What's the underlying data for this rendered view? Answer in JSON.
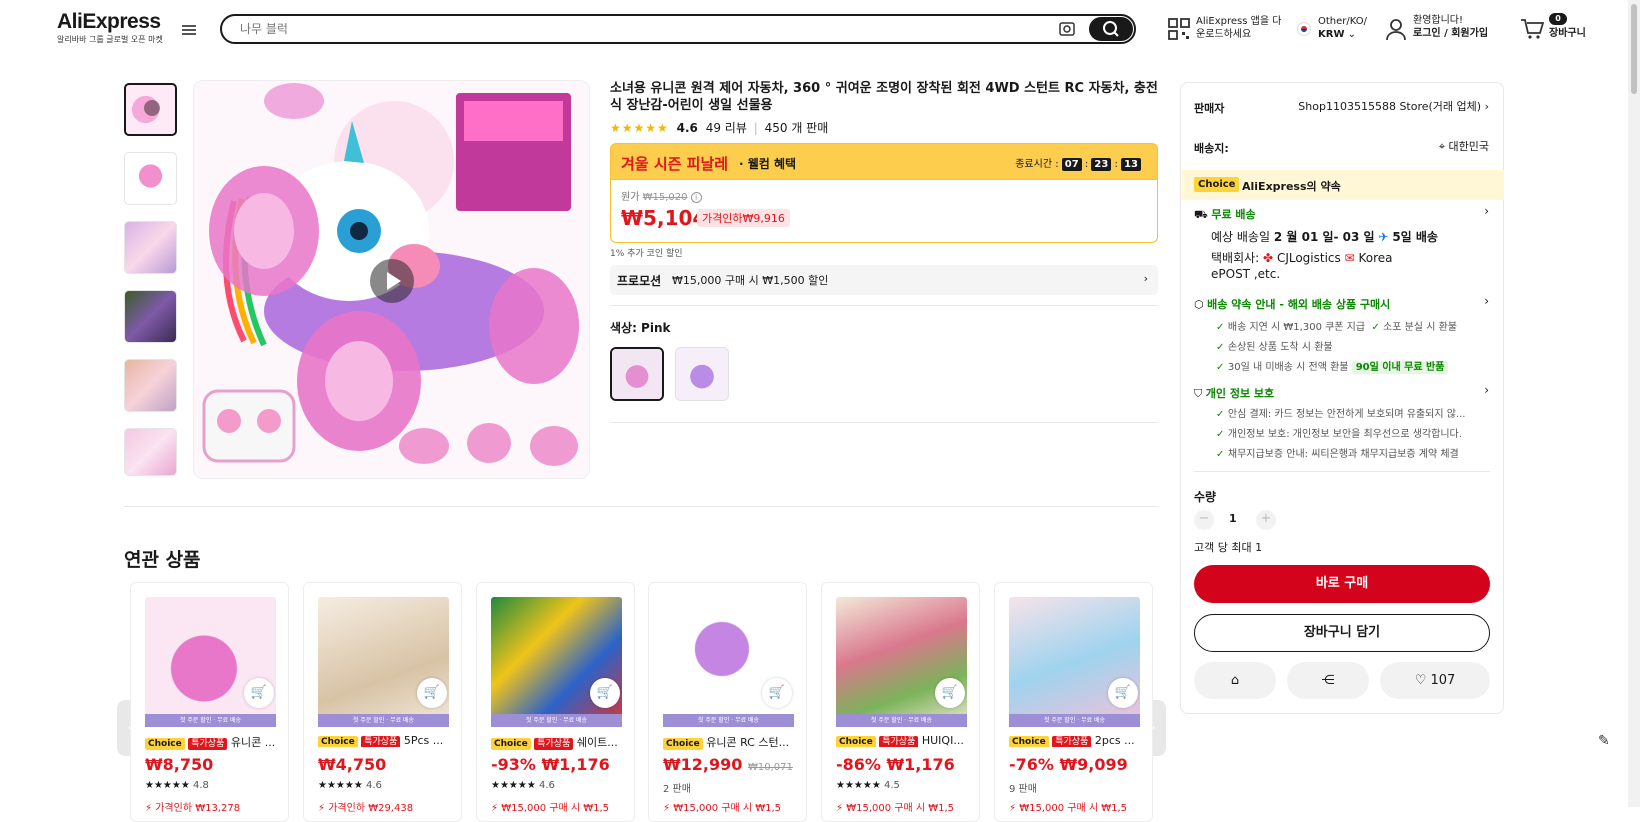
{
  "header": {
    "logo": "AliExpress",
    "logo_sub": "알리바바 그룹 글로벌 오픈 마켓",
    "search_placeholder": "나무 블럭",
    "app_line1": "AliExpress 앱을 다",
    "app_line2": "운로드하세요",
    "region_line1": "Other/KO/",
    "region_line2": "KRW",
    "account_line1": "환영합니다!",
    "account_line2": "로그인 / 회원가입",
    "cart_count": "0",
    "cart_label": "장바구니"
  },
  "product": {
    "title": "소녀용 유니콘 원격 제어 자동차, 360 ° 귀여운 조명이 장착된 회전 4WD 스턴트 RC 자동차, 충전식 장난감-어린이 생일 선물용",
    "rating": "4.6",
    "reviews": "49 리뷰",
    "sold": "450 개 판매",
    "sale_title": "겨울 시즌 피날레",
    "sale_sub": "· 웰컴 혜택",
    "timer_label": "종료시간 :",
    "timer_h": "07",
    "timer_m": "23",
    "timer_s": "13",
    "orig_label": "원가",
    "orig_price": "₩15,020",
    "price": "₩5,104",
    "discount_tag": "가격인하₩9,916",
    "coin": "1% 추가 코인 할인",
    "promo_label": "프로모션",
    "promo_text": "₩15,000 구매 시 ₩1,500 할인",
    "color_label": "색상: Pink"
  },
  "panel": {
    "seller_label": "판매자",
    "seller_name": "Shop1103515588 Store(거래 업체)",
    "ship_to_label": "배송지:",
    "ship_to": "대한민국",
    "choice_tag": "Choice",
    "choice_title": "AliExpress의 약속",
    "free_ship": "무료 배송",
    "eta_prefix": "예상 배송일",
    "eta_dates": "2 월 01 일- 03 일",
    "eta_days": "5일 배송",
    "carrier_label": "택배회사:",
    "carrier1": "CJLogistics",
    "carrier2": "Korea",
    "carrier3": "ePOST ,etc.",
    "promise_title": "배송 약속 안내 - 해외 배송 상품 구매시",
    "promise_1a": "배송 지연 시 ₩1,300 쿠폰 지급",
    "promise_1b": "소포 분실 시 환불",
    "promise_2": "손상된 상품 도착 시 환불",
    "promise_3": "30일 내 미배송 시 전액 환불",
    "promise_3_tag": "90일 이내 무료 반품",
    "privacy_title": "개인 정보 보호",
    "privacy_1": "안심 결제: 카드 정보는 안전하게 보호되며 유출되지 않...",
    "privacy_2": "개인정보 보호: 개인정보 보안을 최우선으로 생각합니다.",
    "privacy_3": "채무지급보증 안내: 씨티은행과 채무지급보증 계약 체결",
    "qty_label": "수량",
    "qty_value": "1",
    "qty_limit": "고객 당 최대 1",
    "buy_now": "바로 구매",
    "add_cart": "장바구니 담기",
    "wishlist_count": "107"
  },
  "related": {
    "title": "연관 상품",
    "band_text": "첫 주문 할인 · 무료 배송",
    "cards": [
      {
        "name": "유니콘 ...",
        "price": "₩8,750",
        "orig": "",
        "rating": "4.8",
        "extra": "가격인하 ₩13,278",
        "spec": true
      },
      {
        "name": "5Pcs ...",
        "price": "₩4,750",
        "orig": "",
        "rating": "4.6",
        "extra": "가격인하 ₩29,438",
        "spec": true
      },
      {
        "name": "쉐이트...",
        "price": "-93% ₩1,176",
        "orig": "",
        "rating": "4.6",
        "extra": "₩15,000 구매 시 ₩1,5",
        "spec": true
      },
      {
        "name": "유니콘 RC 스턴...",
        "price": "₩12,990",
        "orig": "₩10,071",
        "rating": "",
        "sold": "2 판매",
        "extra": "₩15,000 구매 시 ₩1,5",
        "spec": false
      },
      {
        "name": "HUIQI...",
        "price": "-86% ₩1,176",
        "orig": "",
        "rating": "4.5",
        "extra": "₩15,000 구매 시 ₩1,5",
        "spec": true
      },
      {
        "name": "2pcs ...",
        "price": "-76% ₩9,099",
        "orig": "",
        "rating": "",
        "sold": "9 판매",
        "extra": "₩15,000 구매 시 ₩1,5",
        "spec": true
      }
    ]
  },
  "colors": {
    "accent_red": "#e0161d",
    "buy_red": "#d3031c",
    "sale_yellow": "#fdcd4e",
    "choice_yellow": "#fdd33c",
    "green": "#0a8800"
  }
}
